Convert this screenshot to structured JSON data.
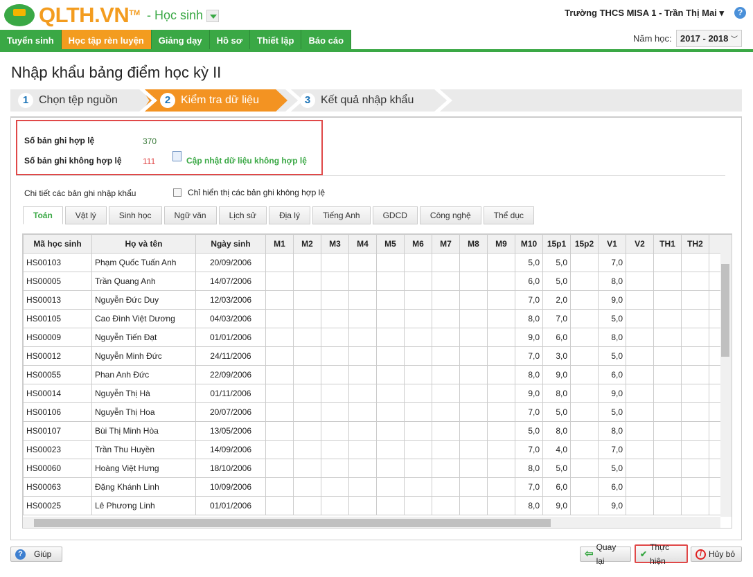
{
  "header": {
    "logo": "QLTH.VN",
    "tm": "TM",
    "module": "- Học sinh",
    "user": "Trường THCS MISA 1 - Trần Thị Mai",
    "year_label": "Năm học:",
    "year": "2017 - 2018"
  },
  "nav": [
    "Tuyển sinh",
    "Học tập rèn luyện",
    "Giảng dạy",
    "Hồ sơ",
    "Thiết lập",
    "Báo cáo"
  ],
  "page_title": "Nhập khẩu bảng điểm học kỳ II",
  "steps": [
    {
      "num": "1",
      "label": "Chọn tệp nguồn"
    },
    {
      "num": "2",
      "label": "Kiểm tra dữ liệu"
    },
    {
      "num": "3",
      "label": "Kết quả nhập khẩu"
    }
  ],
  "summary": {
    "valid_label": "Số bản ghi hợp lệ",
    "valid": "370",
    "invalid_label": "Số bản ghi không hợp lệ",
    "invalid": "111",
    "update_link": "Cập nhật dữ liệu không hợp lệ"
  },
  "details_label": "Chi tiết các bản ghi nhập khẩu",
  "filter_label": "Chỉ hiển thị các bản ghi không hợp lệ",
  "subjects": [
    "Toán",
    "Vật lý",
    "Sinh học",
    "Ngữ văn",
    "Lịch sử",
    "Địa lý",
    "Tiếng Anh",
    "GDCD",
    "Công nghệ",
    "Thể dục"
  ],
  "columns": [
    "Mã học sinh",
    "Họ và tên",
    "Ngày sinh",
    "M1",
    "M2",
    "M3",
    "M4",
    "M5",
    "M6",
    "M7",
    "M8",
    "M9",
    "M10",
    "15p1",
    "15p2",
    "V1",
    "V2",
    "TH1",
    "TH2"
  ],
  "rows": [
    [
      "HS00103",
      "Phạm Quốc Tuấn Anh",
      "20/09/2006",
      "5,0",
      "5,0",
      "7,0"
    ],
    [
      "HS00005",
      "Trần Quang Anh",
      "14/07/2006",
      "6,0",
      "5,0",
      "8,0"
    ],
    [
      "HS00013",
      "Nguyễn Đức Duy",
      "12/03/2006",
      "7,0",
      "2,0",
      "9,0"
    ],
    [
      "HS00105",
      "Cao Đình Việt Dương",
      "04/03/2006",
      "8,0",
      "7,0",
      "5,0"
    ],
    [
      "HS00009",
      "Nguyễn Tiến Đạt",
      "01/01/2006",
      "9,0",
      "6,0",
      "8,0"
    ],
    [
      "HS00012",
      "Nguyễn Minh Đức",
      "24/11/2006",
      "7,0",
      "3,0",
      "5,0"
    ],
    [
      "HS00055",
      "Phan Anh Đức",
      "22/09/2006",
      "8,0",
      "9,0",
      "6,0"
    ],
    [
      "HS00014",
      "Nguyễn Thị Hà",
      "01/11/2006",
      "9,0",
      "8,0",
      "9,0"
    ],
    [
      "HS00106",
      "Nguyễn Thị Hoa",
      "20/07/2006",
      "7,0",
      "5,0",
      "5,0"
    ],
    [
      "HS00107",
      "Bùi Thị Minh Hòa",
      "13/05/2006",
      "5,0",
      "8,0",
      "8,0"
    ],
    [
      "HS00023",
      "Trần Thu Huyền",
      "14/09/2006",
      "7,0",
      "4,0",
      "7,0"
    ],
    [
      "HS00060",
      "Hoàng Việt Hưng",
      "18/10/2006",
      "8,0",
      "5,0",
      "5,0"
    ],
    [
      "HS00063",
      "Đặng Khánh Linh",
      "10/09/2006",
      "7,0",
      "6,0",
      "6,0"
    ],
    [
      "HS00025",
      "Lê Phương Linh",
      "01/01/2006",
      "8,0",
      "9,0",
      "9,0"
    ]
  ],
  "footer": {
    "help": "Giúp",
    "back": "Quay lại",
    "execute": "Thực hiện",
    "cancel": "Hủy bỏ"
  }
}
